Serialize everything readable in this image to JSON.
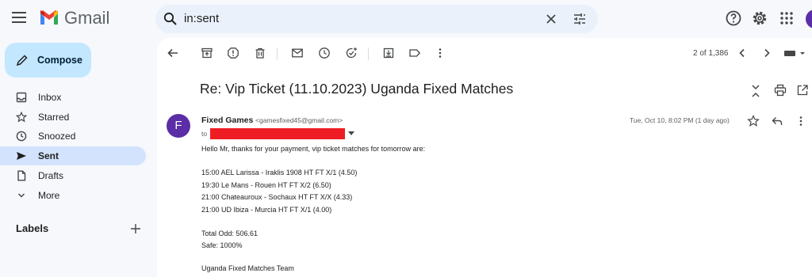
{
  "app": {
    "name": "Gmail"
  },
  "search": {
    "query": "in:sent"
  },
  "sidebar": {
    "compose_label": "Compose",
    "items": [
      {
        "label": "Inbox",
        "icon": "inbox-icon"
      },
      {
        "label": "Starred",
        "icon": "star-icon"
      },
      {
        "label": "Snoozed",
        "icon": "clock-icon"
      },
      {
        "label": "Sent",
        "icon": "send-icon",
        "active": true
      },
      {
        "label": "Drafts",
        "icon": "draft-icon"
      },
      {
        "label": "More",
        "icon": "chevron-down-icon"
      }
    ],
    "labels_title": "Labels"
  },
  "toolbar": {
    "pager": "2 of 1,386"
  },
  "message": {
    "subject": "Re: Vip Ticket (11.10.2023) Uganda Fixed Matches",
    "sender_initial": "F",
    "sender_name": "Fixed Games",
    "sender_email": "<gamesfixed45@gmail.com>",
    "to_label": "to",
    "date": "Tue, Oct 10, 8:02 PM (1 day ago)",
    "body": [
      "Hello Mr, thanks for your payment, vip ticket matches for tomorrow are:",
      "15:00 AEL Larissa - Iraklis 1908 HT FT X/1 (4.50)",
      "19:30 Le Mans - Rouen HT FT X/2 (6.50)",
      "21:00 Chateauroux - Sochaux HT FT X/X (4.33)",
      "21:00 UD Ibiza - Murcia HT FT X/1 (4.00)",
      "Total Odd: 506.61",
      "Safe: 1000%",
      "Uganda Fixed Matches Team"
    ]
  },
  "colors": {
    "background": "#f6f8fc",
    "compose": "#c2e7ff",
    "active_nav": "#d3e3fd",
    "search": "#eaf1fb",
    "avatar": "#5b2da6",
    "redaction": "#ee1d23"
  }
}
